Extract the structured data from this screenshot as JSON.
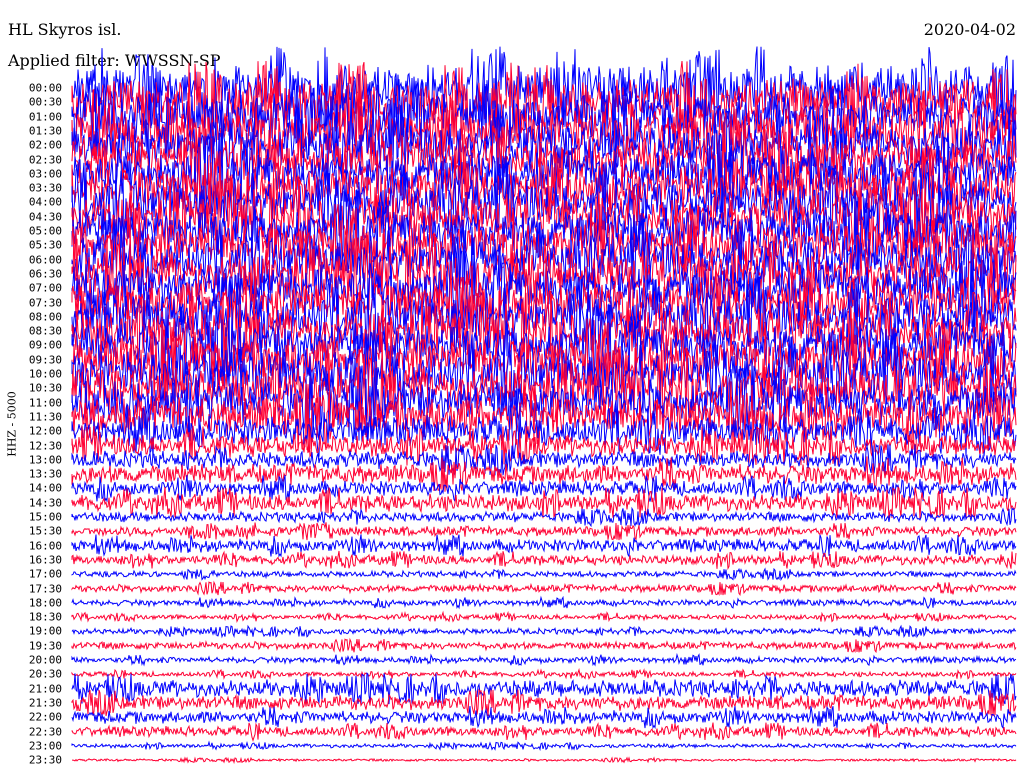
{
  "header": {
    "station": "HL Skyros isl.",
    "date": "2020-04-02",
    "filter": "Applied filter: WWSSN-SP"
  },
  "channel_label": "HHZ - 5000",
  "colors": {
    "trace_a": "#0000ff",
    "trace_b": "#ff0033",
    "background": "#ffffff"
  },
  "time_labels": [
    "00:00",
    "00:30",
    "01:00",
    "01:30",
    "02:00",
    "02:30",
    "03:00",
    "03:30",
    "04:00",
    "04:30",
    "05:00",
    "05:30",
    "06:00",
    "06:30",
    "07:00",
    "07:30",
    "08:00",
    "08:30",
    "09:00",
    "09:30",
    "10:00",
    "10:30",
    "11:00",
    "11:30",
    "12:00",
    "12:30",
    "13:00",
    "13:30",
    "14:00",
    "14:30",
    "15:00",
    "15:30",
    "16:00",
    "16:30",
    "17:00",
    "17:30",
    "18:00",
    "18:30",
    "19:00",
    "19:30",
    "20:00",
    "20:30",
    "21:00",
    "21:30",
    "22:00",
    "22:30",
    "23:00",
    "23:30"
  ],
  "trace_amplitudes": [
    1.0,
    1.0,
    1.0,
    1.0,
    1.0,
    1.0,
    1.0,
    1.0,
    1.0,
    1.0,
    1.0,
    1.0,
    1.0,
    1.0,
    1.0,
    1.0,
    0.95,
    0.95,
    0.9,
    0.9,
    0.9,
    0.9,
    0.85,
    0.8,
    0.6,
    0.45,
    0.35,
    0.4,
    0.3,
    0.35,
    0.2,
    0.2,
    0.25,
    0.2,
    0.12,
    0.15,
    0.12,
    0.1,
    0.12,
    0.15,
    0.12,
    0.1,
    0.35,
    0.3,
    0.25,
    0.2,
    0.08,
    0.05
  ]
}
